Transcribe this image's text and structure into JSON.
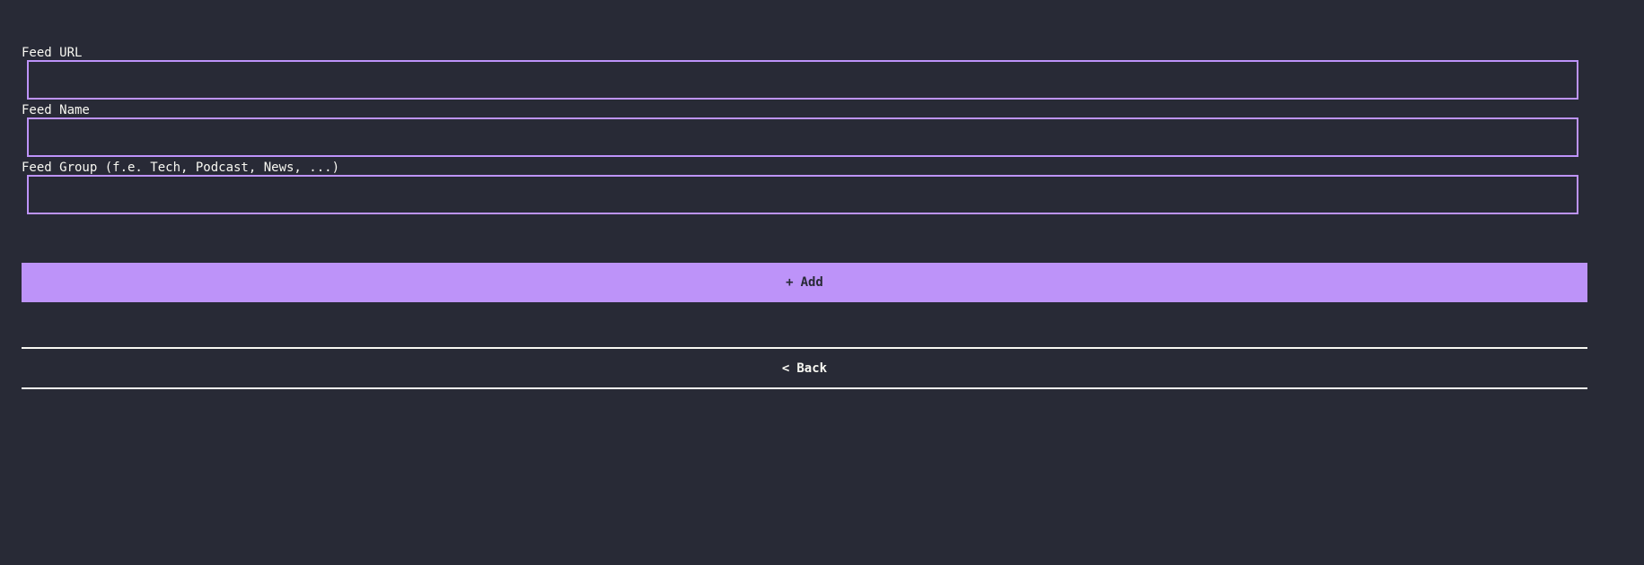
{
  "form": {
    "fields": [
      {
        "label": "Feed URL",
        "value": "",
        "placeholder": ""
      },
      {
        "label": "Feed Name",
        "value": "",
        "placeholder": ""
      },
      {
        "label": "Feed Group (f.e. Tech, Podcast, News, ...)",
        "value": "",
        "placeholder": ""
      }
    ]
  },
  "actions": {
    "add": {
      "icon": "+",
      "icon_name": "plus-icon",
      "label": "Add"
    },
    "back": {
      "icon": "<",
      "icon_name": "chevron-left-icon",
      "label": "Back"
    }
  },
  "colors": {
    "background": "#282a36",
    "accent": "#bd93f9",
    "text": "#f8f8f2"
  }
}
